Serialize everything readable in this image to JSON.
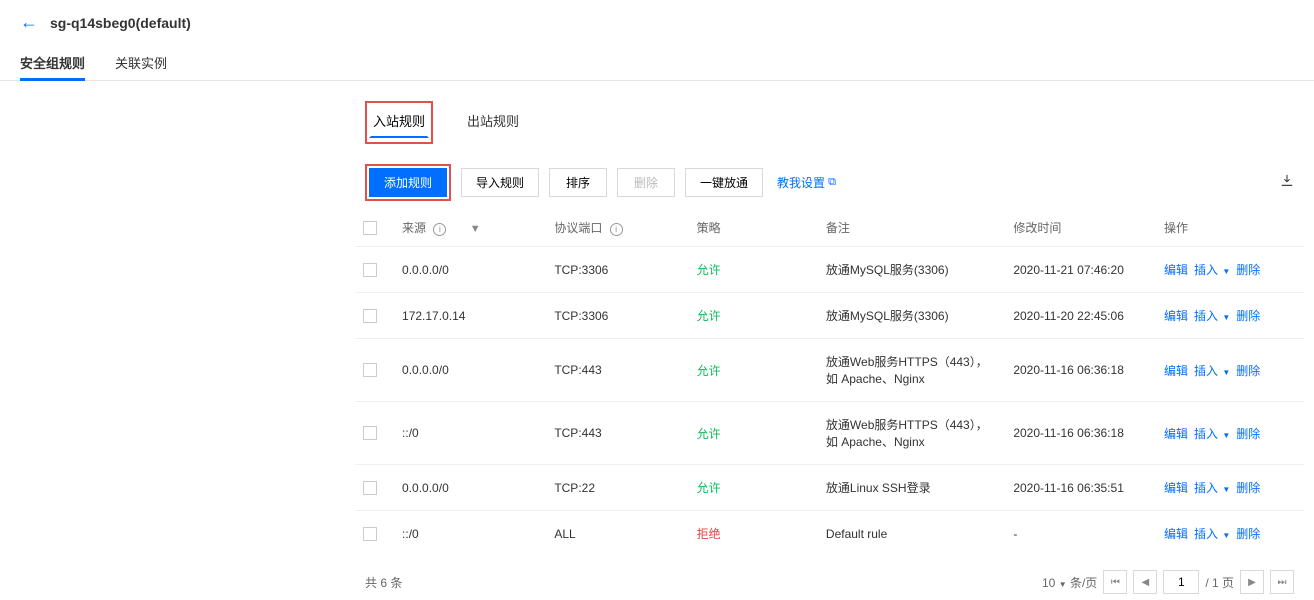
{
  "header": {
    "title": "sg-q14sbeg0(default)"
  },
  "main_tabs": [
    {
      "label": "安全组规则",
      "active": true
    },
    {
      "label": "关联实例",
      "active": false
    }
  ],
  "sub_tabs": [
    {
      "label": "入站规则",
      "active": true
    },
    {
      "label": "出站规则",
      "active": false
    }
  ],
  "toolbar": {
    "add_rule": "添加规则",
    "import_rule": "导入规则",
    "sort": "排序",
    "delete": "删除",
    "one_click": "一键放通",
    "help": "教我设置"
  },
  "columns": {
    "source": "来源",
    "protocol": "协议端口",
    "policy": "策略",
    "note": "备注",
    "modified": "修改时间",
    "operation": "操作"
  },
  "rows": [
    {
      "source": "0.0.0.0/0",
      "protocol": "TCP:3306",
      "policy": "允许",
      "policy_class": "allow",
      "note": "放通MySQL服务(3306)",
      "modified": "2020-11-21 07:46:20"
    },
    {
      "source": "172.17.0.14",
      "protocol": "TCP:3306",
      "policy": "允许",
      "policy_class": "allow",
      "note": "放通MySQL服务(3306)",
      "modified": "2020-11-20 22:45:06"
    },
    {
      "source": "0.0.0.0/0",
      "protocol": "TCP:443",
      "policy": "允许",
      "policy_class": "allow",
      "note": "放通Web服务HTTPS（443），如 Apache、Nginx",
      "modified": "2020-11-16 06:36:18"
    },
    {
      "source": "::/0",
      "protocol": "TCP:443",
      "policy": "允许",
      "policy_class": "allow",
      "note": "放通Web服务HTTPS（443），如 Apache、Nginx",
      "modified": "2020-11-16 06:36:18"
    },
    {
      "source": "0.0.0.0/0",
      "protocol": "TCP:22",
      "policy": "允许",
      "policy_class": "allow",
      "note": "放通Linux SSH登录",
      "modified": "2020-11-16 06:35:51"
    },
    {
      "source": "::/0",
      "protocol": "ALL",
      "policy": "拒绝",
      "policy_class": "deny",
      "note": "Default rule",
      "modified": "-"
    }
  ],
  "actions": {
    "edit": "编辑",
    "insert": "插入",
    "delete": "删除"
  },
  "footer": {
    "total_prefix": "共",
    "total_count": "6",
    "total_suffix": "条",
    "page_size": "10",
    "page_size_suffix": "条/页",
    "current_page": "1",
    "total_pages": "/ 1 页"
  }
}
